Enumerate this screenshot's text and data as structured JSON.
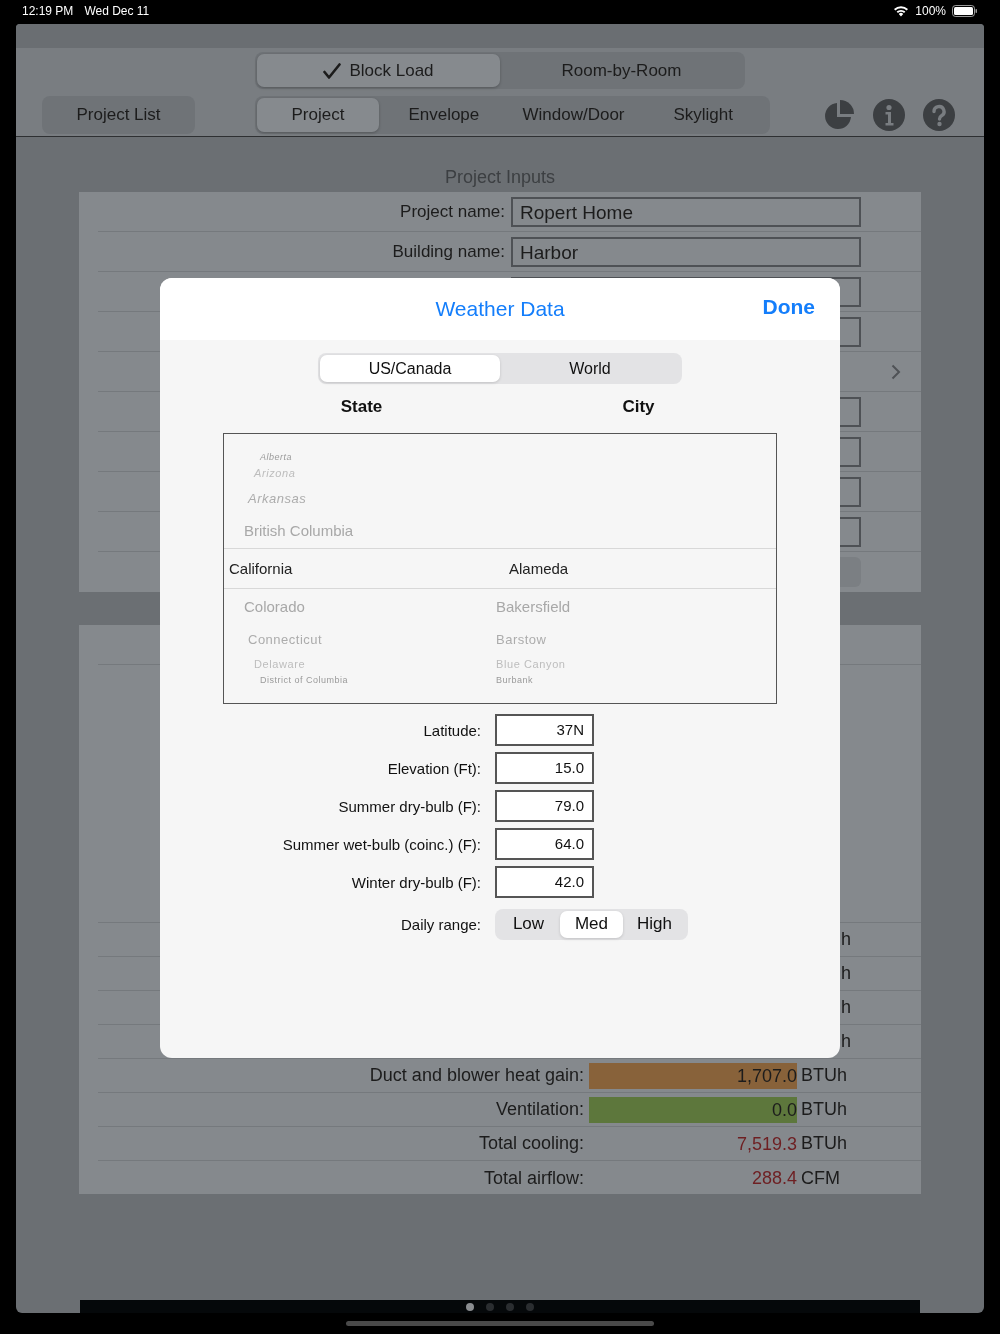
{
  "status_bar": {
    "time": "12:19 PM",
    "date": "Wed Dec 11",
    "battery": "100%"
  },
  "mode_tabs": [
    {
      "label": "Block Load",
      "selected": true
    },
    {
      "label": "Room-by-Room",
      "selected": false
    }
  ],
  "project_list_button": "Project List",
  "section_tabs": [
    {
      "label": "Project",
      "selected": true
    },
    {
      "label": "Envelope",
      "selected": false
    },
    {
      "label": "Window/Door",
      "selected": false
    },
    {
      "label": "Skylight",
      "selected": false
    }
  ],
  "heading": "Project Inputs",
  "project_fields": [
    {
      "label": "Project name:",
      "value": "Ropert Home"
    },
    {
      "label": "Building name:",
      "value": "Harbor"
    }
  ],
  "hidden_unit_rows": [
    "h",
    "h",
    "h",
    "h"
  ],
  "results": [
    {
      "kind": "bar",
      "label": "Duct and blower heat gain:",
      "value": "1,707.0",
      "unit": "BTUh",
      "color": "#88623a"
    },
    {
      "kind": "bar",
      "label": "Ventilation:",
      "value": "0.0",
      "unit": "BTUh",
      "color": "#5d773c"
    },
    {
      "kind": "plain",
      "label": "Total cooling:",
      "value": "7,519.3",
      "unit": "BTUh",
      "color": "#6e1f22"
    },
    {
      "kind": "plain",
      "label": "Total airflow:",
      "value": "288.4",
      "unit": "CFM",
      "color": "#6e1f22"
    }
  ],
  "pages": [
    {
      "selected": true
    },
    {
      "selected": false
    },
    {
      "selected": false
    },
    {
      "selected": false
    }
  ],
  "dialog": {
    "title": "Weather Data",
    "done": "Done",
    "regions": [
      {
        "label": "US/Canada",
        "selected": true
      },
      {
        "label": "World",
        "selected": false
      }
    ],
    "state_header": "State",
    "city_header": "City",
    "states": [
      {
        "name": "Alberta",
        "selected": false
      },
      {
        "name": "Arizona",
        "selected": false
      },
      {
        "name": "Arkansas",
        "selected": false
      },
      {
        "name": "British Columbia",
        "selected": false
      },
      {
        "name": "California",
        "selected": true
      },
      {
        "name": "Colorado",
        "selected": false
      },
      {
        "name": "Connecticut",
        "selected": false
      },
      {
        "name": "Delaware",
        "selected": false
      },
      {
        "name": "District of Columbia",
        "selected": false
      }
    ],
    "cities": [
      {
        "name": "Alameda",
        "selected": true
      },
      {
        "name": "Bakersfield",
        "selected": false
      },
      {
        "name": "Barstow",
        "selected": false
      },
      {
        "name": "Blue Canyon",
        "selected": false
      },
      {
        "name": "Burbank",
        "selected": false
      }
    ],
    "fields": [
      {
        "label": "Latitude:",
        "value": "37N"
      },
      {
        "label": "Elevation (Ft):",
        "value": "15.0"
      },
      {
        "label": "Summer dry-bulb (F):",
        "value": "79.0"
      },
      {
        "label": "Summer wet-bulb (coinc.) (F):",
        "value": "64.0"
      },
      {
        "label": "Winter dry-bulb (F):",
        "value": "42.0"
      }
    ],
    "daily_range": {
      "label": "Daily range:",
      "options": [
        {
          "label": "Low",
          "selected": false
        },
        {
          "label": "Med",
          "selected": true
        },
        {
          "label": "High",
          "selected": false
        }
      ]
    }
  }
}
